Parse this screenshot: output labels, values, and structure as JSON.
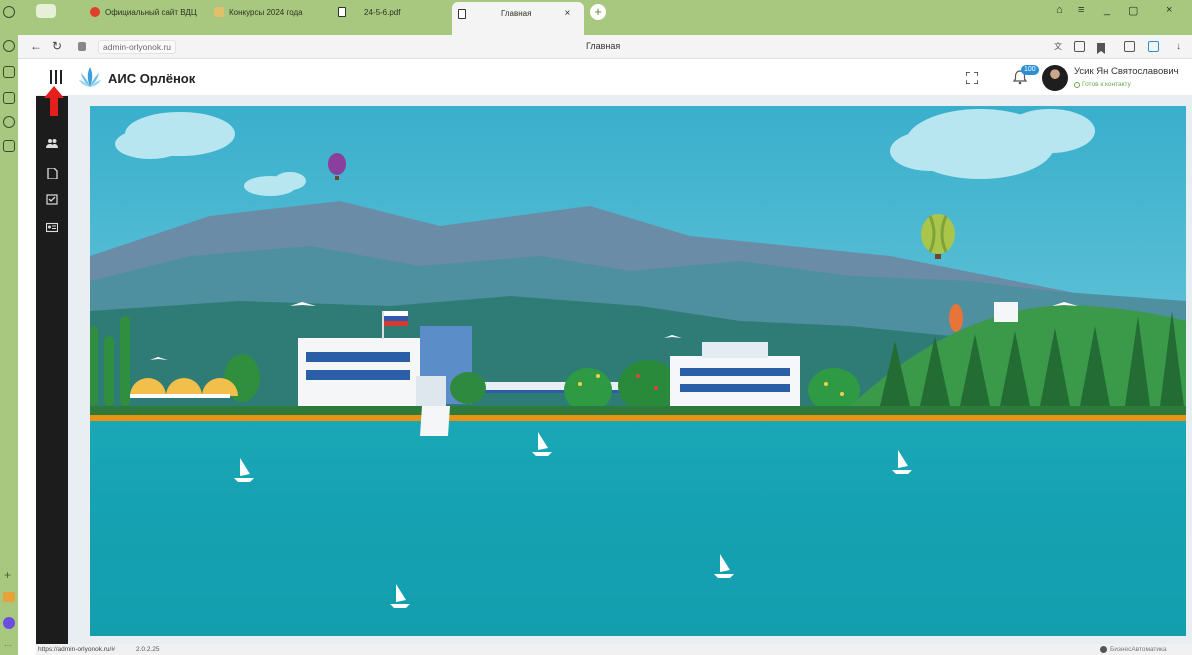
{
  "browser": {
    "tabs": [
      {
        "label": "Официальный сайт ВДЦ",
        "icon": "opera-icon"
      },
      {
        "label": "Конкурсы 2024 года",
        "icon": "bookmark-icon"
      },
      {
        "label": "",
        "icon": "document-icon"
      },
      {
        "label": "24-5-6.pdf",
        "icon": "pdf-icon"
      },
      {
        "label": "Главная",
        "icon": "document-icon",
        "active": true
      }
    ],
    "url": "admin-orlyonok.ru",
    "page_title": "Главная",
    "new_tab": "+",
    "close_tab": "×",
    "win_controls": [
      "≡",
      "_",
      "▢",
      "×"
    ]
  },
  "app": {
    "title": "АИС Орлёнок",
    "notifications_count": "100",
    "user": {
      "name": "Усик Ян Святославович",
      "status": "Готов к контакту"
    }
  },
  "sidebar": {
    "items": [
      {
        "name": "people-icon"
      },
      {
        "name": "document-icon"
      },
      {
        "name": "checklist-icon"
      },
      {
        "name": "id-card-icon"
      }
    ]
  },
  "statusbar": {
    "link": "https://admin-orlyonok.ru/#",
    "version": "2.0.2.25",
    "brand": "БизнесАвтоматика"
  },
  "colors": {
    "browser_chrome": "#a8c880",
    "sidebar": "#1c1c1c",
    "sea": "#17a6b5",
    "sky": "#3fb4cf",
    "accent": "#2c8fd6"
  }
}
